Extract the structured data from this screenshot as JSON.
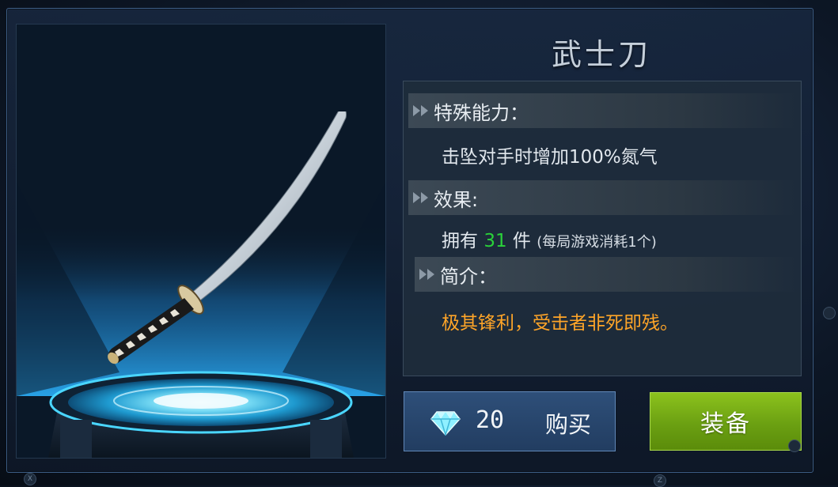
{
  "item": {
    "name": "武士刀",
    "image": "katana"
  },
  "sections": {
    "ability": {
      "title": "特殊能力：",
      "text": "击坠对手时增加100%氮气"
    },
    "effect": {
      "title": "效果:",
      "own_prefix": "拥有",
      "count": "31",
      "own_unit": "件",
      "note": "(每局游戏消耗1个)"
    },
    "intro": {
      "title": "简介：",
      "text": "极其锋利，受击者非死即残。"
    }
  },
  "buy": {
    "icon": "diamond-icon",
    "price": "20",
    "label": "购买"
  },
  "equip": {
    "label": "装备"
  },
  "corner_hints": {
    "left": "X",
    "right": "Z"
  },
  "colors": {
    "count_green": "#2ad23a",
    "intro_orange": "#ffa528",
    "buy_blue": "#2a4a72",
    "equip_green": "#7ab318",
    "beam_cyan": "#2aa8f0"
  }
}
